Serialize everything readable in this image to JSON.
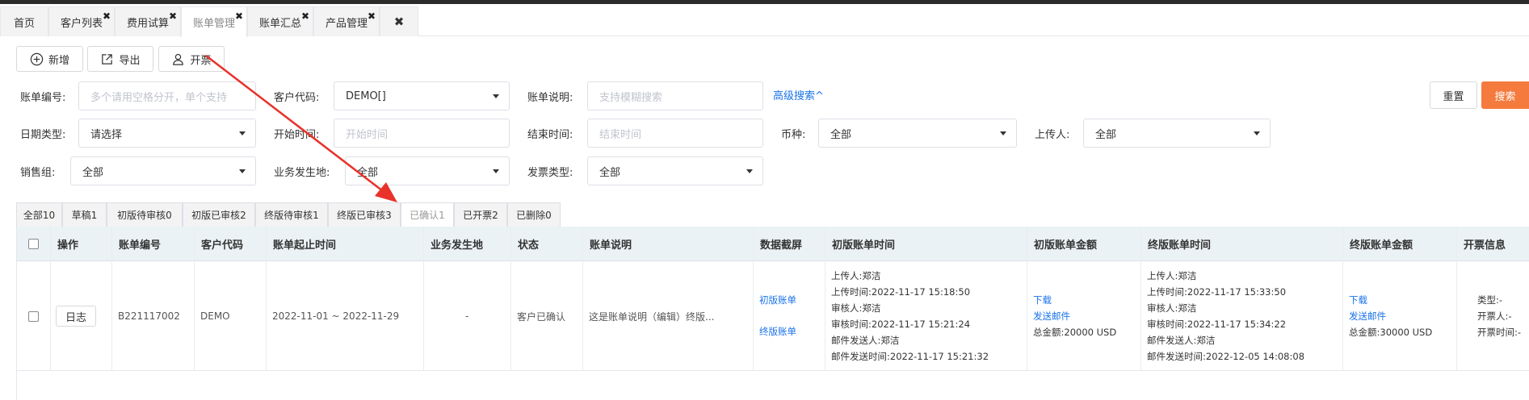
{
  "tabs": [
    {
      "label": "首页",
      "closable": false
    },
    {
      "label": "客户列表",
      "closable": true
    },
    {
      "label": "费用试算",
      "closable": true
    },
    {
      "label": "账单管理",
      "closable": true,
      "active": true
    },
    {
      "label": "账单汇总",
      "closable": true
    },
    {
      "label": "产品管理",
      "closable": true
    }
  ],
  "close_all": "✖",
  "toolbar": {
    "add": "新增",
    "export": "导出",
    "invoice": "开票"
  },
  "filters": {
    "bill_no_label": "账单编号:",
    "bill_no_placeholder": "多个请用空格分开，单个支持",
    "customer_code_label": "客户代码:",
    "customer_code_value": "DEMO[]",
    "bill_desc_label": "账单说明:",
    "bill_desc_placeholder": "支持模糊搜索",
    "advanced_search": "高级搜索^",
    "date_type_label": "日期类型:",
    "date_type_value": "请选择",
    "start_time_label": "开始时间:",
    "start_time_placeholder": "开始时间",
    "end_time_label": "结束时间:",
    "end_time_placeholder": "结束时间",
    "currency_label": "币种:",
    "currency_value": "全部",
    "uploader_label": "上传人:",
    "uploader_value": "全部",
    "sales_group_label": "销售组:",
    "sales_group_value": "全部",
    "business_place_label": "业务发生地:",
    "business_place_value": "全部",
    "invoice_type_label": "发票类型:",
    "invoice_type_value": "全部",
    "reset": "重置",
    "search": "搜索"
  },
  "status_tabs": [
    "全部10",
    "草稿1",
    "初版待审核0",
    "初版已审核2",
    "终版待审核1",
    "终版已审核3",
    "已确认1",
    "已开票2",
    "已删除0"
  ],
  "status_active_index": 6,
  "table": {
    "headers": [
      "操作",
      "账单编号",
      "客户代码",
      "账单起止时间",
      "业务发生地",
      "状态",
      "账单说明",
      "数据截屏",
      "初版账单时间",
      "初版账单金额",
      "终版账单时间",
      "终版账单金额",
      "开票信息"
    ],
    "rows": [
      {
        "log_button": "日志",
        "bill_no": "B221117002",
        "customer_code": "DEMO",
        "period": "2022-11-01 ~ 2022-11-29",
        "business_place": "-",
        "status": "客户已确认",
        "description": "这是账单说明（编辑）终版...",
        "screenshot_initial": "初版账单",
        "screenshot_final": "终版账单",
        "initial_time_lines": [
          "上传人:郑洁",
          "上传时间:2022-11-17 15:18:50",
          "审核人:郑洁",
          "审核时间:2022-11-17 15:21:24",
          "邮件发送人:郑洁",
          "邮件发送时间:2022-11-17 15:21:32"
        ],
        "initial_download": "下载",
        "initial_send": "发送邮件",
        "initial_total": "总金额:20000 USD",
        "final_time_lines": [
          "上传人:郑洁",
          "上传时间:2022-11-17 15:33:50",
          "审核人:郑洁",
          "审核时间:2022-11-17 15:34:22",
          "邮件发送人:郑洁",
          "邮件发送时间:2022-12-05 14:08:08"
        ],
        "final_download": "下载",
        "final_send": "发送邮件",
        "final_total": "总金额:30000 USD",
        "invoice_lines": [
          "类型:-",
          "开票人:-",
          "开票时间:-"
        ]
      }
    ]
  },
  "colors": {
    "accent_link": "#1a73e8",
    "search_button": "#f47a3e",
    "annotation_arrow": "#e8322a"
  }
}
